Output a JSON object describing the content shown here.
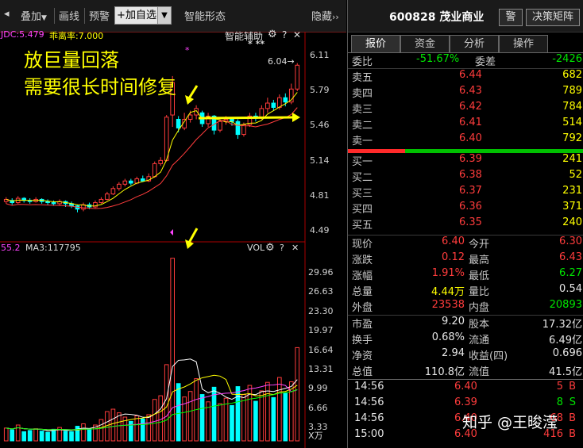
{
  "toolbar": {
    "items": [
      "叠加",
      "画线",
      "预警"
    ],
    "overlay_arrow": "▼",
    "add_label": "+加自选",
    "add_drop": "▼",
    "smart_pattern": "智能形态",
    "hide": "隐藏",
    "hide_icon": "chevrons-right-icon"
  },
  "price_panel": {
    "indicator": "JDC:5.479",
    "deviation": "乖离率:7.000",
    "assist": "智能辅助",
    "gear": "⚙",
    "help": "?",
    "close": "✕",
    "annotation_line1": "放巨量回落",
    "annotation_line2": "需要很长时间修复",
    "high_label": "6.04",
    "high_arrow": "→",
    "stars": "* **",
    "ticks": [
      "6.11",
      "5.79",
      "5.46",
      "5.14",
      "4.81",
      "4.49"
    ]
  },
  "volume_panel": {
    "ma_left": "55.2",
    "ma3": "MA3:117795",
    "vol": "VOL",
    "gear": "⚙",
    "help": "?",
    "close": "✕",
    "ticks": [
      "29.96",
      "26.63",
      "23.30",
      "19.97",
      "16.64",
      "13.31",
      "9.99",
      "6.66",
      "3.33"
    ],
    "unit": "X万"
  },
  "colors": {
    "up": "#ff3c3c",
    "down": "#00ffff",
    "ma_yellow": "#ffff00",
    "ma_magenta": "#ff44ff",
    "ma_white": "#ffffff",
    "ma_green": "#00ff00"
  },
  "quote": {
    "code": "600828",
    "name": "茂业商业",
    "btn_warn": "警",
    "btn_decision": "决策矩阵",
    "tabs": [
      "报价",
      "资金",
      "分析",
      "操作"
    ],
    "weibi_label": "委比",
    "weibi": "-51.67%",
    "weicha_label": "委差",
    "weicha": "-2426",
    "asks": [
      {
        "label": "卖五",
        "price": "6.44",
        "vol": "682"
      },
      {
        "label": "卖四",
        "price": "6.43",
        "vol": "789"
      },
      {
        "label": "卖三",
        "price": "6.42",
        "vol": "784"
      },
      {
        "label": "卖二",
        "price": "6.41",
        "vol": "514"
      },
      {
        "label": "卖一",
        "price": "6.40",
        "vol": "792"
      }
    ],
    "bids": [
      {
        "label": "买一",
        "price": "6.39",
        "vol": "241"
      },
      {
        "label": "买二",
        "price": "6.38",
        "vol": "52"
      },
      {
        "label": "买三",
        "price": "6.37",
        "vol": "231"
      },
      {
        "label": "买四",
        "price": "6.36",
        "vol": "371"
      },
      {
        "label": "买五",
        "price": "6.35",
        "vol": "240"
      }
    ],
    "stats1": [
      {
        "l1": "现价",
        "v1": "6.40",
        "c1": "red",
        "l2": "今开",
        "v2": "6.30",
        "c2": "red"
      },
      {
        "l1": "涨跌",
        "v1": "0.12",
        "c1": "red",
        "l2": "最高",
        "v2": "6.43",
        "c2": "red"
      },
      {
        "l1": "涨幅",
        "v1": "1.91%",
        "c1": "red",
        "l2": "最低",
        "v2": "6.27",
        "c2": "green"
      },
      {
        "l1": "总量",
        "v1": "4.44万",
        "c1": "yellow",
        "l2": "量比",
        "v2": "0.54",
        "c2": "white"
      },
      {
        "l1": "外盘",
        "v1": "23538",
        "c1": "red",
        "l2": "内盘",
        "v2": "20893",
        "c2": "green"
      }
    ],
    "stats2": [
      {
        "l1": "市盈",
        "v1": "9.20",
        "l2": "股本",
        "v2": "17.32亿"
      },
      {
        "l1": "换手",
        "v1": "0.68%",
        "l2": "流通",
        "v2": "6.49亿"
      },
      {
        "l1": "净资",
        "v1": "2.94",
        "l2": "收益(四)",
        "v2": "0.696"
      },
      {
        "l1": "总值",
        "v1": "110.8亿",
        "l2": "流值",
        "v2": "41.5亿"
      }
    ],
    "ticks": [
      {
        "time": "14:56",
        "price": "6.40",
        "vol": "5",
        "side": "B"
      },
      {
        "time": "14:56",
        "price": "6.39",
        "vol": "8",
        "side": "S"
      },
      {
        "time": "14:56",
        "price": "6.40",
        "vol": "68",
        "side": "B"
      },
      {
        "time": "15:00",
        "price": "6.40",
        "vol": "416",
        "side": "B"
      }
    ],
    "watermark": "知乎 @王晙滢"
  }
}
